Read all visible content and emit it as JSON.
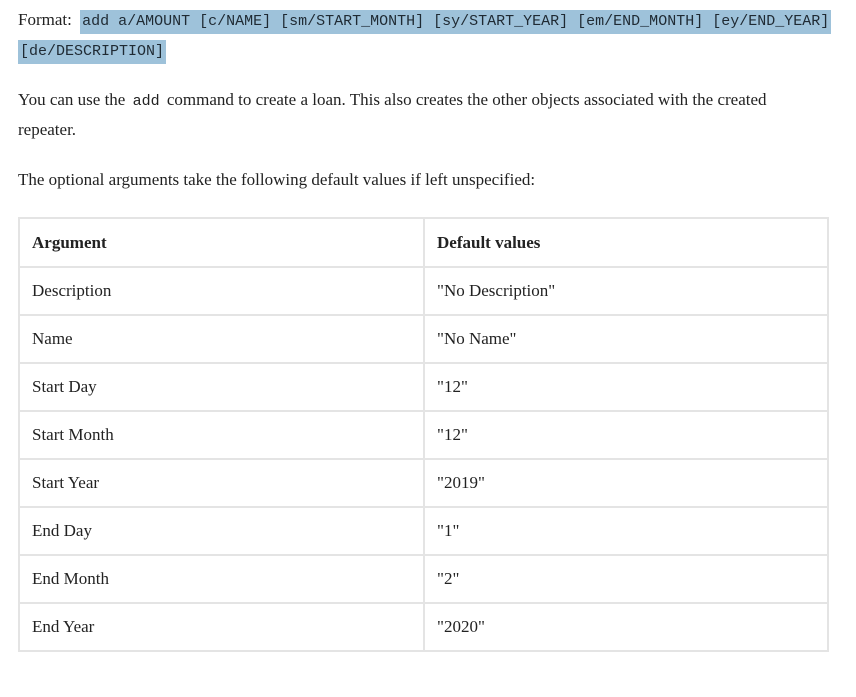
{
  "format": {
    "label": "Format:",
    "syntax": "add a/AMOUNT [c/NAME] [sm/START_MONTH] [sy/START_YEAR] [em/END_MONTH] [ey/END_YEAR] [de/DESCRIPTION]"
  },
  "description": {
    "before_code": "You can use the",
    "code": "add",
    "after_code": "command to create a loan. This also creates the other objects associated with the created repeater."
  },
  "defaults_intro": "The optional arguments take the following default values if left unspecified:",
  "table": {
    "headers": [
      "Argument",
      "Default values"
    ],
    "rows": [
      [
        "Description",
        "\"No Description\""
      ],
      [
        "Name",
        "\"No Name\""
      ],
      [
        "Start Day",
        "\"12\""
      ],
      [
        "Start Month",
        "\"12\""
      ],
      [
        "Start Year",
        "\"2019\""
      ],
      [
        "End Day",
        "\"1\""
      ],
      [
        "End Month",
        "\"2\""
      ],
      [
        "End Year",
        "\"2020\""
      ]
    ]
  },
  "colors": {
    "code_highlight": "#9ec2da",
    "table_border": "#e4e4e4",
    "text": "#222222"
  }
}
